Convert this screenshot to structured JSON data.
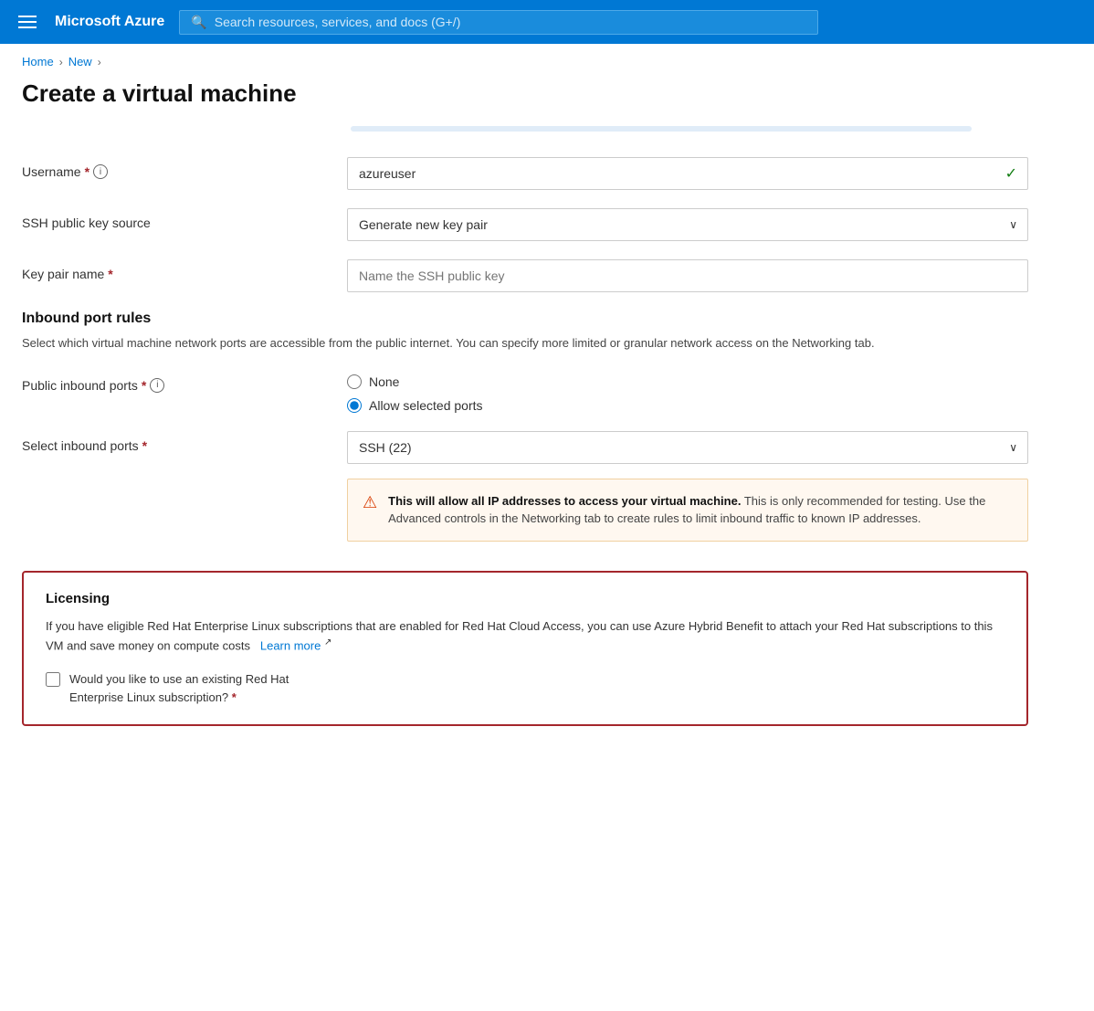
{
  "nav": {
    "brand": "Microsoft Azure",
    "search_placeholder": "Search resources, services, and docs (G+/)"
  },
  "breadcrumb": {
    "home": "Home",
    "new": "New"
  },
  "page": {
    "title": "Create a virtual machine"
  },
  "form": {
    "username_label": "Username",
    "username_value": "azureuser",
    "ssh_key_source_label": "SSH public key source",
    "ssh_key_source_value": "Generate new key pair",
    "key_pair_name_label": "Key pair name",
    "key_pair_name_placeholder": "Name the SSH public key",
    "inbound_rules_heading": "Inbound port rules",
    "inbound_rules_desc": "Select which virtual machine network ports are accessible from the public internet. You can specify more limited or granular network access on the Networking tab.",
    "public_inbound_label": "Public inbound ports",
    "radio_none": "None",
    "radio_allow": "Allow selected ports",
    "select_inbound_label": "Select inbound ports",
    "select_inbound_value": "SSH (22)",
    "warning_text_bold": "This will allow all IP addresses to access your virtual machine.",
    "warning_text_rest": " This is only recommended for testing.  Use the Advanced controls in the Networking tab to create rules to limit inbound traffic to known IP addresses.",
    "licensing_title": "Licensing",
    "licensing_desc": "If you have eligible Red Hat Enterprise Linux subscriptions that are enabled for Red Hat Cloud Access, you can use Azure Hybrid Benefit to attach your Red Hat subscriptions to this VM and save money on compute costs",
    "learn_more": "Learn more",
    "checkbox_label_line1": "Would you like to use an existing Red Hat",
    "checkbox_label_line2": "Enterprise Linux subscription?",
    "required_star": "*"
  },
  "icons": {
    "hamburger": "☰",
    "search": "🔍",
    "chevron_down": "∨",
    "check": "✓",
    "warning_triangle": "⚠",
    "external_link": "↗"
  }
}
